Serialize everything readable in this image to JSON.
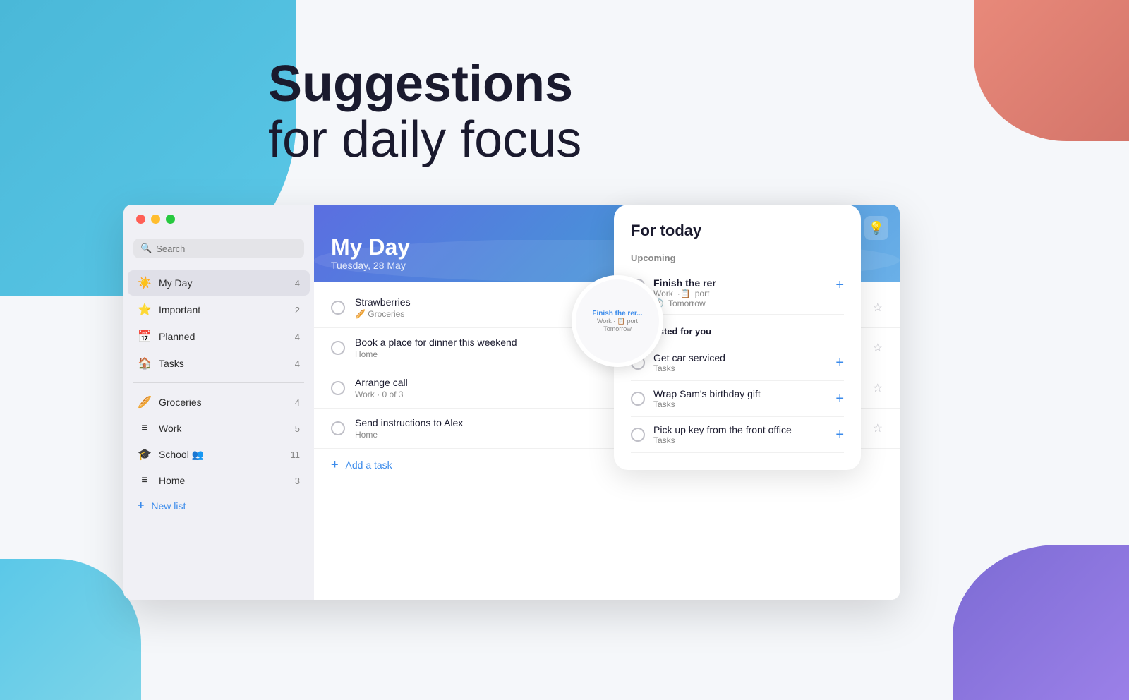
{
  "page": {
    "title_line1": "Suggestions",
    "title_line2": "for daily focus"
  },
  "background_shapes": {
    "colors": {
      "blue": "#5bc8e8",
      "salmon": "#d4756a",
      "purple": "#7c6bd4"
    }
  },
  "sidebar": {
    "search": {
      "placeholder": "Search"
    },
    "nav_items": [
      {
        "id": "my-day",
        "label": "My Day",
        "icon": "☀️",
        "count": "4",
        "active": true
      },
      {
        "id": "important",
        "label": "Important",
        "icon": "⭐",
        "count": "2",
        "active": false
      },
      {
        "id": "planned",
        "label": "Planned",
        "icon": "📅",
        "count": "4",
        "active": false
      },
      {
        "id": "tasks",
        "label": "Tasks",
        "icon": "🏠",
        "count": "4",
        "active": false
      }
    ],
    "list_items": [
      {
        "id": "groceries",
        "label": "Groceries",
        "icon": "🥖",
        "count": "4"
      },
      {
        "id": "work",
        "label": "Work",
        "icon": "≡",
        "count": "5"
      },
      {
        "id": "school",
        "label": "School",
        "icon": "🎓",
        "count": "11",
        "shared": true
      },
      {
        "id": "home",
        "label": "Home",
        "icon": "≡",
        "count": "3"
      }
    ],
    "new_list_label": "New list"
  },
  "main": {
    "header": {
      "title": "My Day",
      "subtitle": "Tuesday, 28 May",
      "icon": "💡"
    },
    "tasks": [
      {
        "id": "task-1",
        "name": "Strawberries",
        "meta": "🥖 Groceries",
        "starred": false
      },
      {
        "id": "task-2",
        "name": "Book a place for dinner this weekend",
        "meta": "Home",
        "starred": false
      },
      {
        "id": "task-3",
        "name": "Arrange call",
        "meta": "Work · 0 of 3",
        "starred": false
      },
      {
        "id": "task-4",
        "name": "Send instructions to Alex",
        "meta": "Home",
        "starred": false
      }
    ],
    "add_task_label": "Add a task"
  },
  "for_today": {
    "title": "For today",
    "upcoming_section_label": "Upcoming",
    "upcoming_items": [
      {
        "id": "upcoming-1",
        "name": "Finish the rer",
        "meta_list": "Work",
        "meta_icon": "📋",
        "meta_extra": "port",
        "meta_date": "Tomorrow"
      }
    ],
    "suggested_section_label": "Suggested for you",
    "suggested_items": [
      {
        "id": "suggested-1",
        "name": "Get car serviced",
        "list": "Tasks"
      },
      {
        "id": "suggested-2",
        "name": "Wrap Sam's birthday gift",
        "list": "Tasks"
      },
      {
        "id": "suggested-3",
        "name": "Pick up key from the front office",
        "list": "Tasks"
      }
    ]
  }
}
